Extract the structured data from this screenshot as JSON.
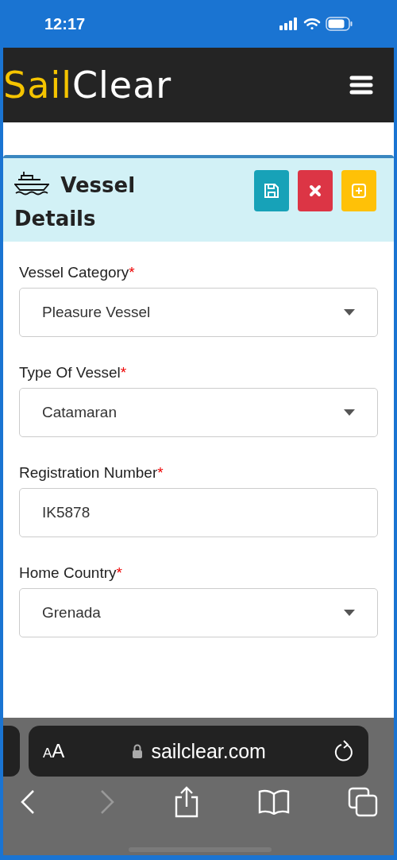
{
  "status_bar": {
    "time": "12:17"
  },
  "header": {
    "logo": [
      {
        "text": "Sail",
        "color": "#f5c400"
      },
      {
        "text": "Clear",
        "color": "#ffffff"
      }
    ]
  },
  "card": {
    "title_lines": [
      "Vessel",
      "Details"
    ],
    "buttons": [
      {
        "kind": "save",
        "color": "#17a2b8"
      },
      {
        "kind": "close",
        "color": "#dc3545"
      },
      {
        "kind": "add",
        "color": "#ffc107"
      }
    ]
  },
  "fields": [
    {
      "label": "Vessel Category",
      "required_mark": "*",
      "kind": "select",
      "value": "Pleasure Vessel"
    },
    {
      "label": "Type Of Vessel",
      "required_mark": "*",
      "kind": "select",
      "value": "Catamaran"
    },
    {
      "label": "Registration Number",
      "required_mark": "*",
      "kind": "input",
      "value": "IK5878"
    },
    {
      "label": "Home Country",
      "required_mark": "*",
      "kind": "select",
      "value": "Grenada"
    }
  ],
  "browser": {
    "text_size": "AA",
    "url": "sailclear.com",
    "back_disabled": false,
    "forward_disabled": true
  }
}
